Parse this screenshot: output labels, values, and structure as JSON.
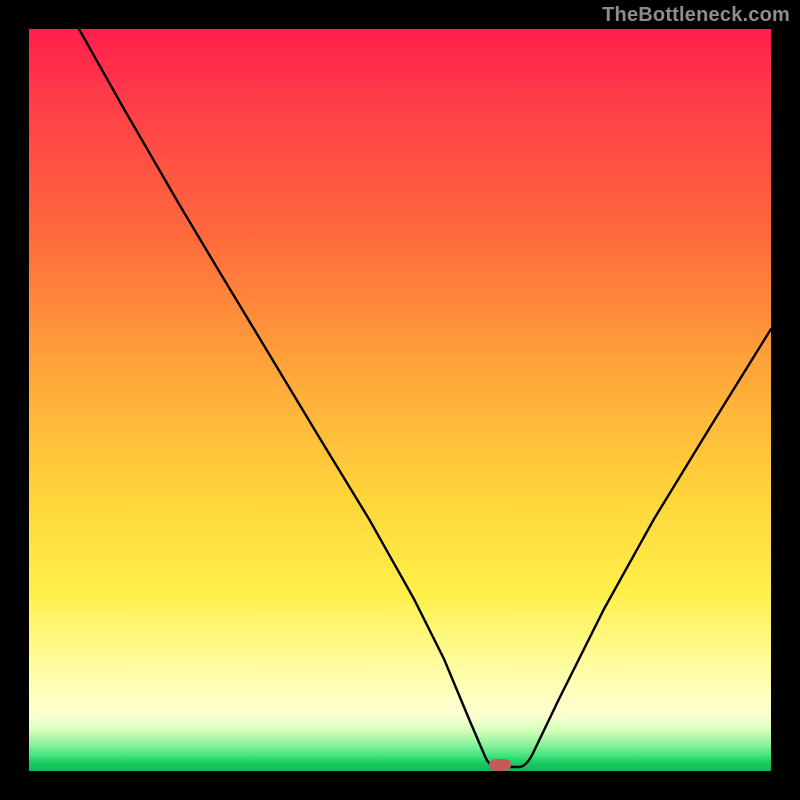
{
  "watermark": "TheBottleneck.com",
  "marker": {
    "x_pct": 63.5,
    "y_pct": 99.2,
    "color": "#c65a5a"
  },
  "chart_data": {
    "type": "line",
    "title": "",
    "xlabel": "",
    "ylabel": "",
    "xlim": [
      0,
      100
    ],
    "ylim": [
      0,
      100
    ],
    "grid": false,
    "legend": false,
    "background": "vertical red→yellow→green gradient",
    "series": [
      {
        "name": "bottleneck-curve",
        "x": [
          0,
          6,
          12,
          18,
          24,
          30,
          36,
          42,
          48,
          54,
          58,
          60,
          63,
          66,
          70,
          76,
          82,
          88,
          94,
          100
        ],
        "values": [
          100,
          92,
          84,
          76,
          68,
          60,
          54,
          46,
          36,
          24,
          12,
          4,
          0,
          0,
          6,
          18,
          32,
          44,
          54,
          62
        ]
      }
    ],
    "annotations": [
      {
        "type": "marker",
        "shape": "pill",
        "x": 63.5,
        "y": 0.8,
        "color": "#c65a5a"
      }
    ]
  }
}
